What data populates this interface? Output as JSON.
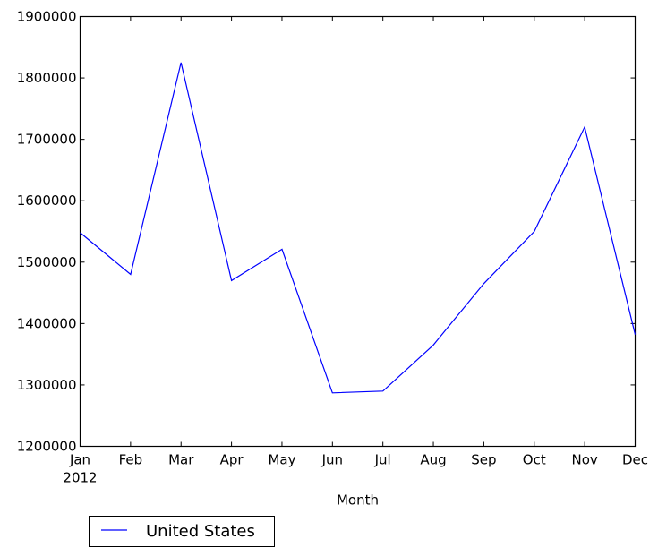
{
  "chart_data": {
    "type": "line",
    "title": "",
    "xlabel": "Month",
    "ylabel": "",
    "categories": [
      "Jan",
      "Feb",
      "Mar",
      "Apr",
      "May",
      "Jun",
      "Jul",
      "Aug",
      "Sep",
      "Oct",
      "Nov",
      "Dec"
    ],
    "x_sublabel": "2012",
    "ylim": [
      1200000,
      1900000
    ],
    "yticks": [
      1200000,
      1300000,
      1400000,
      1500000,
      1600000,
      1700000,
      1800000,
      1900000
    ],
    "ytick_labels": [
      "1200000",
      "1300000",
      "1400000",
      "1500000",
      "1600000",
      "1700000",
      "1800000",
      "1900000"
    ],
    "grid": false,
    "legend_position": "below-left",
    "series": [
      {
        "name": "United States",
        "color": "#0000ff",
        "values": [
          1548000,
          1480000,
          1825000,
          1470000,
          1521000,
          1287000,
          1290000,
          1365000,
          1465000,
          1550000,
          1720000,
          1382000
        ]
      }
    ]
  }
}
